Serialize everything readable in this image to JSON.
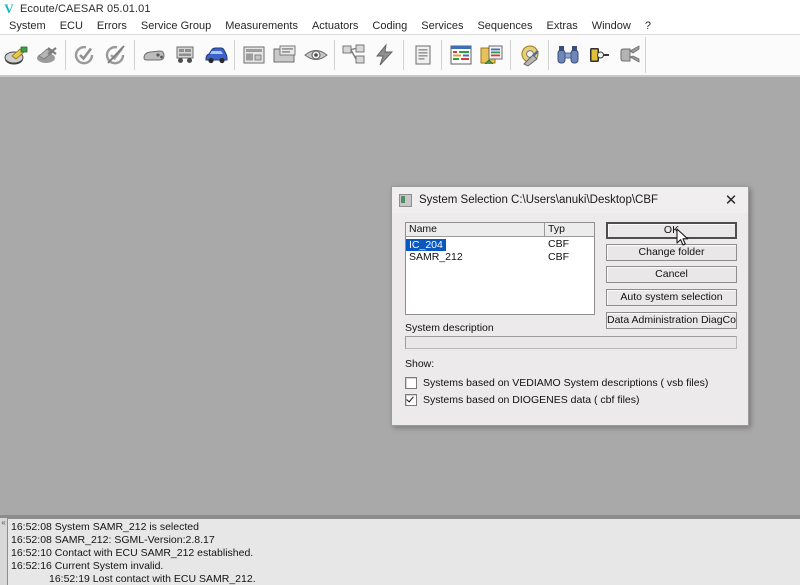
{
  "window": {
    "title": "Ecoute/CAESAR 05.01.01",
    "logo_icon": "v-logo-icon"
  },
  "menubar": {
    "items": [
      {
        "label": "System"
      },
      {
        "label": "ECU"
      },
      {
        "label": "Errors"
      },
      {
        "label": "Service Group"
      },
      {
        "label": "Measurements"
      },
      {
        "label": "Actuators"
      },
      {
        "label": "Coding"
      },
      {
        "label": "Services"
      },
      {
        "label": "Sequences"
      },
      {
        "label": "Extras"
      },
      {
        "label": "Window"
      },
      {
        "label": "?"
      }
    ]
  },
  "toolbar": {
    "groups": [
      {
        "buttons": [
          {
            "icon": "open-system-icon",
            "name": "open-system"
          },
          {
            "icon": "close-system-icon",
            "name": "close-system"
          }
        ]
      },
      {
        "buttons": [
          {
            "icon": "check-ecu-icon",
            "name": "check-ecu"
          },
          {
            "icon": "disconnect-ecu-icon",
            "name": "disconnect-ecu"
          }
        ]
      },
      {
        "buttons": [
          {
            "icon": "ecu-identification-icon",
            "name": "ecu-identification"
          },
          {
            "icon": "ecu-variant-icon",
            "name": "ecu-variant"
          },
          {
            "icon": "vehicle-icon",
            "name": "vehicle"
          }
        ]
      },
      {
        "buttons": [
          {
            "icon": "errors-icon",
            "name": "errors-memory"
          },
          {
            "icon": "error-folder-icon",
            "name": "error-folder"
          },
          {
            "icon": "view-icon",
            "name": "view-live-data"
          }
        ]
      },
      {
        "buttons": [
          {
            "icon": "service-group-icon",
            "name": "service-group"
          },
          {
            "icon": "actuators-icon",
            "name": "actuators"
          }
        ]
      },
      {
        "buttons": [
          {
            "icon": "document-icon",
            "name": "document-log"
          }
        ]
      },
      {
        "buttons": [
          {
            "icon": "measurements-icon",
            "name": "measurements"
          },
          {
            "icon": "coding-folder-icon",
            "name": "coding"
          }
        ]
      },
      {
        "buttons": [
          {
            "icon": "settings-tools-icon",
            "name": "settings-tools"
          }
        ]
      },
      {
        "buttons": [
          {
            "icon": "binoculars-icon",
            "name": "search"
          },
          {
            "icon": "connector-icon",
            "name": "connector"
          },
          {
            "icon": "plug-icon",
            "name": "plug"
          }
        ]
      }
    ]
  },
  "dialog": {
    "icon": "system-selection-icon",
    "title": "System Selection  C:\\Users\\anuki\\Desktop\\CBF",
    "close_label": "✕",
    "file_list": {
      "columns": [
        "Name",
        "Typ"
      ],
      "rows": [
        {
          "name": "IC_204",
          "typ": "CBF",
          "selected": true
        },
        {
          "name": "SAMR_212",
          "typ": "CBF",
          "selected": false
        }
      ]
    },
    "buttons": [
      {
        "label": "OK",
        "name": "ok-button",
        "focused": true
      },
      {
        "label": "Change folder",
        "name": "change-folder-button",
        "focused": false
      },
      {
        "label": "Cancel",
        "name": "cancel-button",
        "focused": false
      },
      {
        "label": "Auto system selection",
        "name": "auto-system-selection-button",
        "focused": false
      },
      {
        "label": "Data Administration DiagCon",
        "name": "data-administration-diagcon-button",
        "focused": false
      }
    ],
    "system_description": {
      "label": "System description",
      "value": "",
      "placeholder": ""
    },
    "show": {
      "label": "Show:",
      "options": [
        {
          "label": "Systems based on VEDIAMO System descriptions ( vsb files)",
          "checked": false,
          "name": "checkbox-vediamo"
        },
        {
          "label": "Systems based on DIOGENES data ( cbf files)",
          "checked": true,
          "name": "checkbox-diogenes"
        }
      ]
    }
  },
  "log": {
    "gutter_mark": "«",
    "lines": [
      {
        "text": "16:52:08 System SAMR_212 is selected",
        "indented": false
      },
      {
        "text": "16:52:08 SAMR_212: SGML-Version:2.8.17",
        "indented": false
      },
      {
        "text": "16:52:10 Contact with ECU SAMR_212 established.",
        "indented": false
      },
      {
        "text": "16:52:16 Current System invalid.",
        "indented": false
      },
      {
        "text": "16:52:19 Lost contact with ECU SAMR_212.",
        "indented": true
      }
    ]
  },
  "colors": {
    "workspace": "#a9a9a9",
    "selection": "#0a57c2",
    "accent": "#14b8c4",
    "dialog_bg": "#eceaea"
  }
}
